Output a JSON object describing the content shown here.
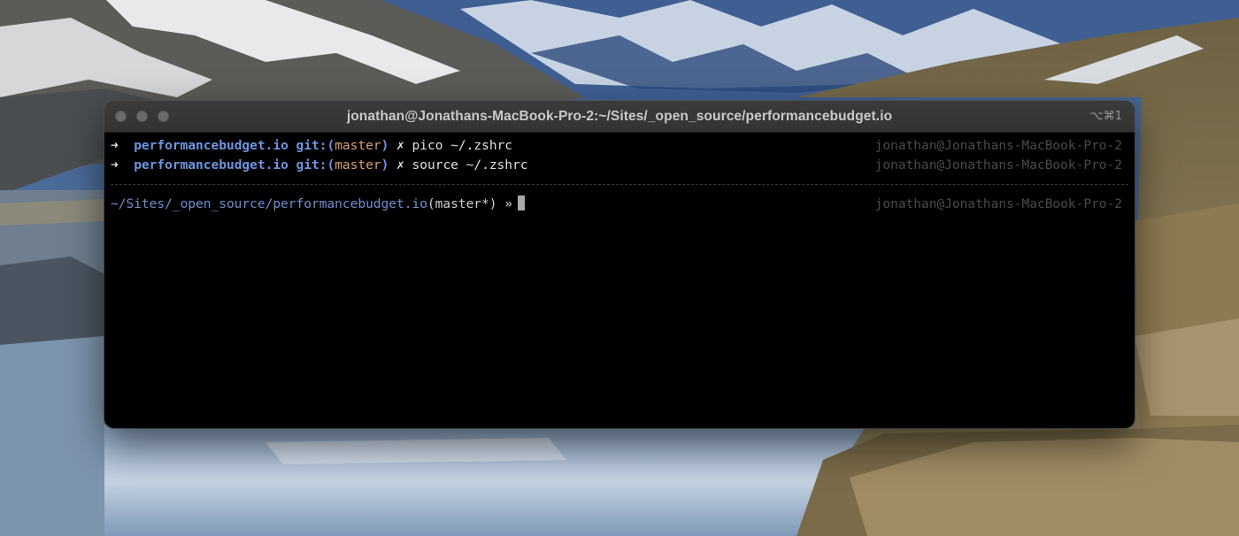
{
  "window": {
    "title": "jonathan@Jonathans-MacBook-Pro-2:~/Sites/_open_source/performancebudget.io",
    "shortcut": "⌥⌘1"
  },
  "terminal": {
    "history": [
      {
        "arrow": "➜",
        "dir": "performancebudget.io",
        "git_prefix": "git:(",
        "branch": "master",
        "git_suffix": ")",
        "dirty": "✗",
        "command": "pico ~/.zshrc",
        "right_prompt": "jonathan@Jonathans-MacBook-Pro-2"
      },
      {
        "arrow": "➜",
        "dir": "performancebudget.io",
        "git_prefix": "git:(",
        "branch": "master",
        "git_suffix": ")",
        "dirty": "✗",
        "command": "source ~/.zshrc",
        "right_prompt": "jonathan@Jonathans-MacBook-Pro-2"
      }
    ],
    "current": {
      "path": "~/Sites/_open_source/performancebudget.io",
      "branch": "(master*)",
      "symbol": "»",
      "right_prompt": "jonathan@Jonathans-MacBook-Pro-2"
    }
  },
  "colors": {
    "dir": "#6f94e0",
    "branch": "#d8a070",
    "path": "#6f8fcf",
    "right_prompt": "#4a4a4a"
  }
}
